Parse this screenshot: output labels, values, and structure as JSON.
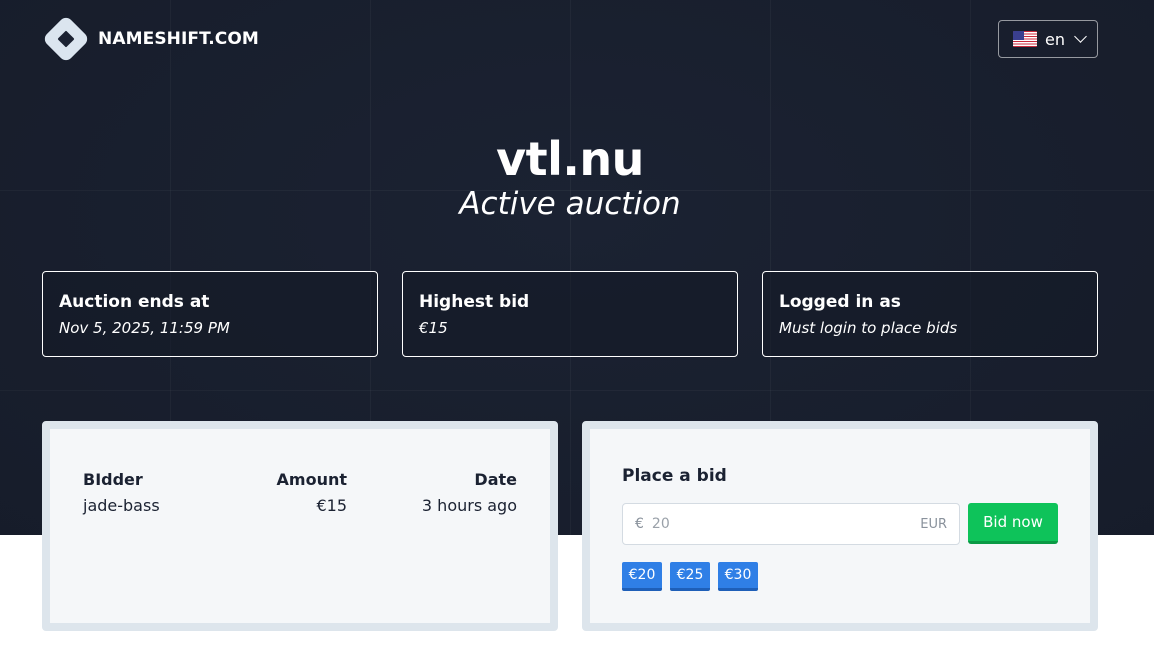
{
  "brand": {
    "name": "NAMESHIFT.COM",
    "logo_icon": "nameshift-logo-icon"
  },
  "language": {
    "code": "en",
    "flag_icon": "us-flag-icon"
  },
  "auction": {
    "domain": "vtl.nu",
    "status": "Active auction"
  },
  "info_cards": [
    {
      "label": "Auction ends at",
      "value": "Nov 5, 2025, 11:59 PM"
    },
    {
      "label": "Highest bid",
      "value": "€15"
    },
    {
      "label": "Logged in as",
      "value": "Must login to place bids"
    }
  ],
  "bids": {
    "headers": {
      "bidder": "BIdder",
      "amount": "Amount",
      "date": "Date"
    },
    "rows": [
      {
        "bidder": "jade-bass",
        "amount": "€15",
        "date": "3 hours ago"
      }
    ]
  },
  "place_bid": {
    "title": "Place a bid",
    "currency_symbol": "€",
    "placeholder": "20",
    "currency_code": "EUR",
    "button_label": "Bid now",
    "quick_bids": [
      "€20",
      "€25",
      "€30"
    ]
  },
  "colors": {
    "hero_bg": "#1b2232",
    "bid_button": "#0ec35a",
    "quick_bid": "#2f7fe6"
  }
}
